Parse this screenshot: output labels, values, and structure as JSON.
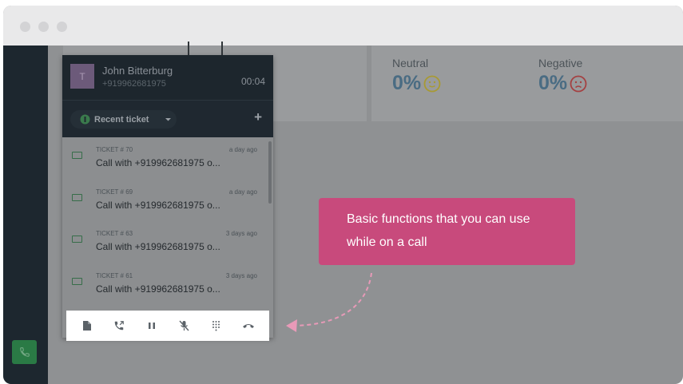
{
  "call": {
    "caller_name": "John Bitterburg",
    "caller_number": "+919962681975",
    "avatar_initial": "T",
    "timer": "00:04"
  },
  "ticket_bar": {
    "recent_ticket_label": "Recent ticket",
    "add_label": "+"
  },
  "tickets": [
    {
      "number": "TICKET # 70",
      "time": "a day ago",
      "title": "Call with +919962681975 o..."
    },
    {
      "number": "TICKET # 69",
      "time": "a day ago",
      "title": "Call with +919962681975 o..."
    },
    {
      "number": "TICKET # 63",
      "time": "3 days ago",
      "title": "Call with +919962681975 o..."
    },
    {
      "number": "TICKET # 61",
      "time": "3 days ago",
      "title": "Call with +919962681975 o..."
    }
  ],
  "sentiment": {
    "neutral_label": "Neutral",
    "neutral_value": "0%",
    "negative_label": "Negative",
    "negative_value": "0%"
  },
  "toolbar_icons": [
    "note-icon",
    "transfer-call-icon",
    "hold-icon",
    "mute-icon",
    "dialpad-icon",
    "hang-up-icon"
  ],
  "callout": {
    "text": "Basic functions that you can use while on a call"
  },
  "colors": {
    "callout": "#c84a7c",
    "accent_green": "#2a7a45",
    "dark_panel": "#1d262d"
  }
}
